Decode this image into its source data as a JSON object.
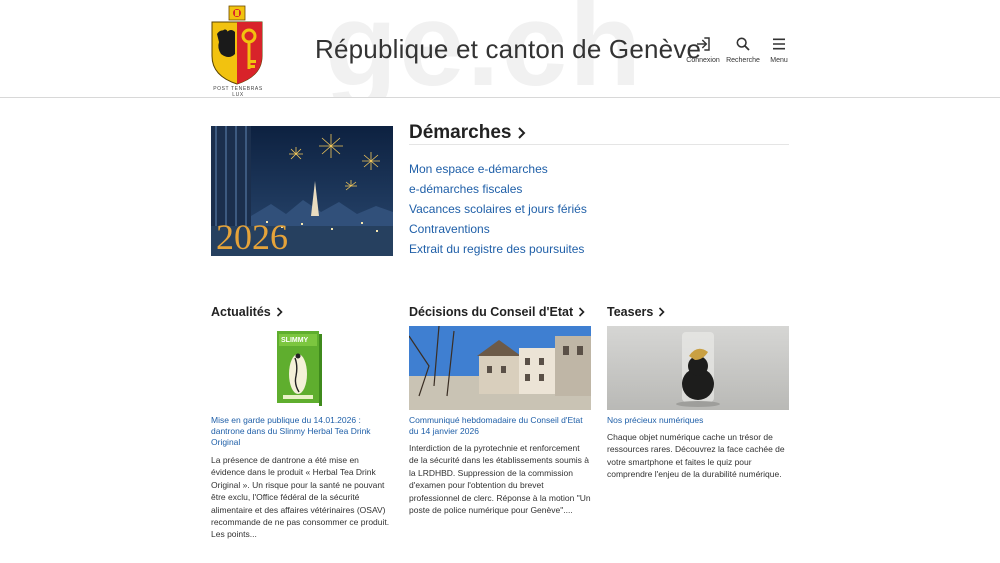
{
  "header": {
    "title": "République et canton de Genève",
    "watermark": "ge.ch",
    "motto": "POST TENEBRAS LUX",
    "actions": [
      {
        "label": "Connexion",
        "icon": "login-icon"
      },
      {
        "label": "Recherche",
        "icon": "search-icon"
      },
      {
        "label": "Menu",
        "icon": "hamburger-menu-icon"
      }
    ]
  },
  "demarches": {
    "title": "Démarches",
    "image_text": "2026",
    "links": [
      "Mon espace e-démarches",
      "e-démarches fiscales",
      "Vacances scolaires et jours fériés",
      "Contraventions",
      "Extrait du registre des poursuites"
    ]
  },
  "sections": [
    {
      "heading": "Actualités",
      "image": "slimmy-tea-package",
      "image_text": "SLIMMY",
      "title": "Mise en garde publique du 14.01.2026 : dantrone dans du Slinmy Herbal Tea Drink Original",
      "text": "La présence de dantrone a été mise en évidence dans le produit « Herbal Tea Drink Original ». Un risque pour la santé ne pouvant être exclu, l'Office fédéral de la sécurité alimentaire et des affaires vétérinaires (OSAV) recommande de ne pas consommer ce produit. Les points..."
    },
    {
      "heading": "Décisions du Conseil d'Etat",
      "image": "old-town-street-photo",
      "title": "Communiqué hebdomadaire du Conseil d'Etat du 14 janvier 2026",
      "text": "Interdiction de la pyrotechnie et renforcement de la sécurité dans les établissements soumis à la LRDHBD. Suppression de la commission d'examen pour l'obtention du brevet professionnel de clerc. Réponse à la motion \"Un poste de police numérique pour Genève\"...."
    },
    {
      "heading": "Teasers",
      "image": "golden-object-display-photo",
      "title": "Nos précieux numériques",
      "text": "Chaque objet numérique cache un trésor de ressources rares. Découvrez la face cachée de votre smartphone et faites le quiz pour comprendre l'enjeu de la durabilité numérique."
    }
  ],
  "colors": {
    "link": "#1f5fa8",
    "text": "#222222",
    "shield_red": "#d8232a",
    "shield_gold": "#f2c20f"
  }
}
